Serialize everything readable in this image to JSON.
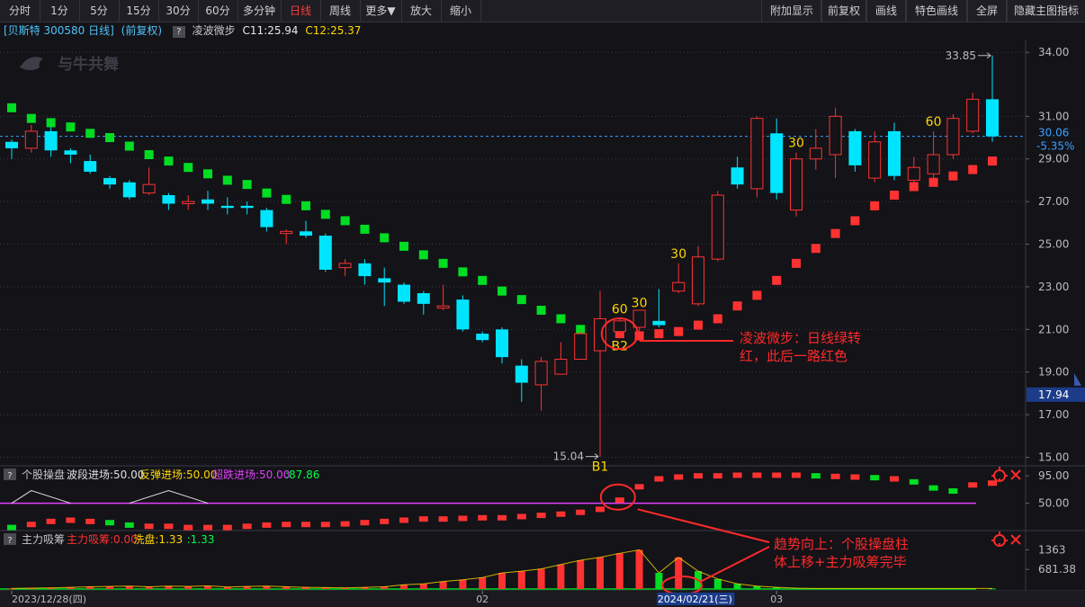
{
  "toolbar": {
    "left": [
      "分时",
      "1分",
      "5分",
      "15分",
      "30分",
      "60分",
      "多分钟",
      "日线",
      "周线",
      "更多▼",
      "放大",
      "缩小"
    ],
    "active": "日线",
    "right": [
      "附加显示",
      "前复权",
      "画线",
      "特色画线",
      "全屏",
      "隐藏主图指标"
    ]
  },
  "info": {
    "stock": "[贝斯特 300580 日线]",
    "adjust": "(前复权)",
    "q": "?",
    "indicator": "凌波微步",
    "c1": "C11:25.94",
    "c2": "C12:25.37"
  },
  "watermark": "与牛共舞",
  "colors": {
    "up": "#ff3232",
    "down": "#00e5ff",
    "green": "#00dd22",
    "grid": "#3a3a44",
    "label": "#ffd700",
    "annotation": "#ff2a2a",
    "magenta": "#e040fb"
  },
  "chart_data": [
    {
      "type": "candlestick",
      "name": "main",
      "ylim": [
        14.6,
        34.6
      ],
      "y_ticks": [
        "34.00",
        "31.00",
        "29.00",
        "27.00",
        "25.00",
        "23.00",
        "21.00",
        "19.00",
        "17.00",
        "15.00"
      ],
      "y_tick_values": [
        34,
        31,
        29,
        27,
        25,
        23,
        21,
        19,
        17,
        15
      ],
      "last_price": "30.06",
      "change_pct": "-5.35%",
      "cursor_price": "17.94",
      "max_label": "33.85",
      "min_label": "15.04",
      "candles": [
        [
          29.8,
          29.5,
          29.9,
          29.0
        ],
        [
          29.5,
          30.3,
          30.6,
          29.3
        ],
        [
          30.3,
          29.4,
          30.5,
          29.1
        ],
        [
          29.4,
          29.2,
          29.5,
          28.8
        ],
        [
          28.9,
          28.4,
          29.2,
          28.3
        ],
        [
          28.1,
          27.8,
          28.2,
          27.6
        ],
        [
          27.9,
          27.2,
          28.0,
          27.1
        ],
        [
          27.4,
          27.8,
          28.6,
          27.3
        ],
        [
          27.3,
          26.9,
          27.4,
          26.6
        ],
        [
          26.9,
          27.0,
          27.3,
          26.6
        ],
        [
          27.1,
          26.9,
          27.5,
          26.6
        ],
        [
          26.8,
          26.7,
          27.2,
          26.4
        ],
        [
          26.8,
          26.7,
          27.0,
          26.4
        ],
        [
          26.6,
          25.8,
          26.7,
          25.6
        ],
        [
          25.5,
          25.6,
          25.7,
          25.0
        ],
        [
          25.6,
          25.4,
          26.1,
          25.3
        ],
        [
          25.4,
          23.8,
          25.5,
          23.7
        ],
        [
          23.9,
          24.1,
          24.3,
          23.5
        ],
        [
          24.1,
          23.5,
          24.3,
          23.1
        ],
        [
          23.4,
          23.2,
          23.9,
          22.1
        ],
        [
          23.1,
          22.3,
          23.2,
          22.2
        ],
        [
          22.7,
          22.2,
          22.8,
          21.7
        ],
        [
          22.0,
          22.1,
          23.1,
          21.9
        ],
        [
          22.4,
          21.0,
          22.6,
          20.9
        ],
        [
          20.8,
          20.5,
          20.9,
          20.4
        ],
        [
          21.0,
          19.7,
          21.1,
          19.4
        ],
        [
          19.3,
          18.5,
          19.6,
          17.6
        ],
        [
          18.4,
          19.5,
          19.7,
          17.2
        ],
        [
          18.9,
          19.6,
          20.4,
          18.9
        ],
        [
          19.6,
          20.8,
          20.9,
          19.6
        ],
        [
          20.0,
          21.5,
          22.8,
          15.04
        ],
        [
          20.9,
          21.4,
          21.5,
          20.7
        ],
        [
          21.1,
          21.9,
          21.8,
          20.8
        ],
        [
          21.4,
          21.2,
          22.9,
          21.1
        ],
        [
          22.8,
          23.2,
          24.1,
          22.7
        ],
        [
          22.2,
          24.4,
          24.9,
          22.1
        ],
        [
          24.3,
          27.3,
          27.5,
          24.2
        ],
        [
          28.6,
          27.8,
          29.1,
          27.6
        ],
        [
          27.6,
          30.9,
          31.0,
          27.2
        ],
        [
          30.2,
          27.4,
          30.9,
          27.1
        ],
        [
          26.6,
          29.0,
          29.3,
          26.3
        ],
        [
          29.0,
          29.5,
          30.4,
          28.5
        ],
        [
          29.2,
          31.0,
          31.4,
          28.1
        ],
        [
          30.3,
          28.7,
          30.4,
          28.4
        ],
        [
          28.1,
          29.8,
          30.3,
          27.9
        ],
        [
          30.3,
          28.2,
          30.7,
          28.0
        ],
        [
          28.0,
          28.6,
          29.1,
          27.9
        ],
        [
          28.3,
          29.2,
          30.3,
          28.1
        ],
        [
          29.2,
          30.9,
          31.1,
          29.0
        ],
        [
          30.3,
          31.8,
          32.1,
          30.2
        ],
        [
          31.8,
          30.06,
          33.85,
          29.8
        ]
      ],
      "lingbo": [
        [
          31.4,
          0
        ],
        [
          30.9,
          0
        ],
        [
          30.7,
          0
        ],
        [
          30.5,
          0
        ],
        [
          30.2,
          0
        ],
        [
          30.0,
          0
        ],
        [
          29.6,
          0
        ],
        [
          29.2,
          0
        ],
        [
          28.9,
          0
        ],
        [
          28.6,
          0
        ],
        [
          28.3,
          0
        ],
        [
          28.0,
          0
        ],
        [
          27.8,
          0
        ],
        [
          27.4,
          0
        ],
        [
          27.1,
          0
        ],
        [
          26.8,
          0
        ],
        [
          26.4,
          0
        ],
        [
          26.1,
          0
        ],
        [
          25.7,
          0
        ],
        [
          25.3,
          0
        ],
        [
          24.9,
          0
        ],
        [
          24.5,
          0
        ],
        [
          24.1,
          0
        ],
        [
          23.7,
          0
        ],
        [
          23.3,
          0
        ],
        [
          22.8,
          0
        ],
        [
          22.4,
          0
        ],
        [
          21.9,
          0
        ],
        [
          21.5,
          0
        ],
        [
          21.0,
          0
        ],
        [
          20.6,
          0
        ],
        [
          20.8,
          1
        ],
        [
          20.7,
          1
        ],
        [
          20.8,
          1
        ],
        [
          20.9,
          1
        ],
        [
          21.2,
          1
        ],
        [
          21.5,
          1
        ],
        [
          22.1,
          1
        ],
        [
          22.6,
          1
        ],
        [
          23.3,
          1
        ],
        [
          24.1,
          1
        ],
        [
          24.8,
          1
        ],
        [
          25.5,
          1
        ],
        [
          26.1,
          1
        ],
        [
          26.8,
          1
        ],
        [
          27.3,
          1
        ],
        [
          27.7,
          1
        ],
        [
          27.9,
          1
        ],
        [
          28.2,
          1
        ],
        [
          28.5,
          1
        ],
        [
          28.9,
          1
        ]
      ],
      "candle_labels": [
        {
          "i": 30,
          "text": "B1"
        },
        {
          "i": 31,
          "text": "B2"
        },
        {
          "i": 31,
          "text": "60"
        },
        {
          "i": 32,
          "text": "30"
        },
        {
          "i": 34,
          "text": "30"
        },
        {
          "i": 40,
          "text": "30"
        },
        {
          "i": 47,
          "text": "60"
        }
      ],
      "annotation": "凌波微步：日线绿转红，此后一路红色"
    },
    {
      "type": "bar",
      "name": "个股操盘",
      "title": "个股操盘",
      "legend": [
        {
          "text": "波段进场:50.00",
          "color": "#e0e0e0"
        },
        {
          "text": "反弹进场:50.00",
          "color": "#ffd700"
        },
        {
          "text": "超跌进场:50.00",
          "color": "#e040fb"
        },
        {
          "text": ":87.86",
          "color": "#00ff44"
        }
      ],
      "y_ticks": [
        "95.00",
        "50.00"
      ],
      "y_tick_values": [
        95,
        50
      ],
      "ylim": [
        5,
        110
      ],
      "line_value": 50,
      "values": [
        [
          10,
          0
        ],
        [
          15,
          1
        ],
        [
          20,
          1
        ],
        [
          22,
          1
        ],
        [
          20,
          1
        ],
        [
          18,
          0
        ],
        [
          14,
          0
        ],
        [
          12,
          1
        ],
        [
          12,
          1
        ],
        [
          10,
          1
        ],
        [
          10,
          1
        ],
        [
          10,
          1
        ],
        [
          12,
          1
        ],
        [
          14,
          1
        ],
        [
          15,
          1
        ],
        [
          15,
          1
        ],
        [
          15,
          1
        ],
        [
          16,
          1
        ],
        [
          18,
          1
        ],
        [
          20,
          1
        ],
        [
          22,
          1
        ],
        [
          24,
          1
        ],
        [
          24,
          1
        ],
        [
          25,
          1
        ],
        [
          26,
          1
        ],
        [
          26,
          1
        ],
        [
          28,
          1
        ],
        [
          30,
          1
        ],
        [
          32,
          1
        ],
        [
          35,
          1
        ],
        [
          40,
          1
        ],
        [
          55,
          1
        ],
        [
          77,
          1
        ],
        [
          90,
          1
        ],
        [
          93,
          1
        ],
        [
          95,
          1
        ],
        [
          95,
          1
        ],
        [
          96,
          1
        ],
        [
          96,
          1
        ],
        [
          96,
          1
        ],
        [
          96,
          1
        ],
        [
          95,
          0
        ],
        [
          94,
          1
        ],
        [
          93,
          1
        ],
        [
          92,
          0
        ],
        [
          90,
          1
        ],
        [
          85,
          0
        ],
        [
          75,
          0
        ],
        [
          70,
          0
        ],
        [
          80,
          1
        ],
        [
          83,
          1
        ]
      ],
      "peaks": [
        [
          0,
          10
        ],
        [
          2,
          14
        ],
        [
          6,
          10
        ],
        [
          8,
          14
        ]
      ]
    },
    {
      "type": "bar",
      "name": "主力吸筹",
      "title": "主力吸筹",
      "legend": [
        {
          "text": "主力吸筹:0.00",
          "color": "#ff3232"
        },
        {
          "text": "洗盘:1.33",
          "color": "#ffd700"
        },
        {
          "text": ":1.33",
          "color": "#00ff44"
        }
      ],
      "y_ticks": [
        "1363",
        "681.38"
      ],
      "y_tick_values": [
        1363,
        681.38
      ],
      "ylim": [
        0,
        1500
      ],
      "values": [
        [
          20,
          1
        ],
        [
          30,
          1
        ],
        [
          40,
          1
        ],
        [
          60,
          1
        ],
        [
          80,
          1
        ],
        [
          90,
          1
        ],
        [
          100,
          1
        ],
        [
          80,
          1
        ],
        [
          100,
          1
        ],
        [
          90,
          1
        ],
        [
          110,
          1
        ],
        [
          70,
          1
        ],
        [
          90,
          1
        ],
        [
          100,
          1
        ],
        [
          80,
          1
        ],
        [
          60,
          1
        ],
        [
          50,
          1
        ],
        [
          40,
          1
        ],
        [
          60,
          1
        ],
        [
          80,
          1
        ],
        [
          150,
          1
        ],
        [
          180,
          1
        ],
        [
          260,
          1
        ],
        [
          320,
          1
        ],
        [
          400,
          1
        ],
        [
          560,
          1
        ],
        [
          620,
          1
        ],
        [
          700,
          1
        ],
        [
          850,
          1
        ],
        [
          1000,
          1
        ],
        [
          1100,
          1
        ],
        [
          1240,
          1
        ],
        [
          1360,
          1
        ],
        [
          560,
          0
        ],
        [
          1100,
          1
        ],
        [
          620,
          0
        ],
        [
          350,
          0
        ],
        [
          180,
          0
        ],
        [
          100,
          0
        ],
        [
          60,
          0
        ],
        [
          30,
          0
        ],
        [
          20,
          0
        ],
        [
          20,
          0
        ],
        [
          20,
          0
        ],
        [
          20,
          0
        ],
        [
          20,
          0
        ],
        [
          20,
          0
        ],
        [
          20,
          0
        ],
        [
          20,
          0
        ],
        [
          20,
          0
        ],
        [
          20,
          0
        ]
      ],
      "annotation": "趋势向上：个股操盘柱体上移+主力吸筹完毕"
    }
  ],
  "x_axis": {
    "labels": [
      {
        "i": 0,
        "text": "2023/12/28(四)"
      },
      {
        "i": 24,
        "text": "02"
      },
      {
        "i": 33,
        "text": "2024/02/21(三)"
      },
      {
        "i": 39,
        "text": "03"
      }
    ]
  }
}
